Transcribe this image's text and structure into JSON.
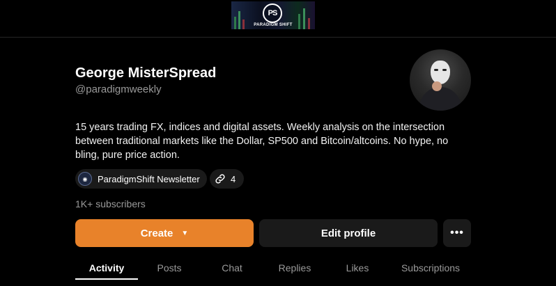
{
  "banner": {
    "logo_text": "PS",
    "brand_text": "PARADIGM SHIFT"
  },
  "profile": {
    "name": "George MisterSpread",
    "handle": "@paradigmweekly",
    "bio": "15 years trading FX, indices and digital assets. Weekly analysis on the intersection between traditional markets like the Dollar, SP500 and Bitcoin/altcoins. No hype, no bling, pure price action.",
    "subscribers": "1K+ subscribers"
  },
  "chips": {
    "newsletter_label": "ParadigmShift Newsletter",
    "links_count": "4"
  },
  "actions": {
    "create_label": "Create",
    "create_caret": "▼",
    "edit_label": "Edit profile",
    "more_label": "•••"
  },
  "tabs": [
    {
      "label": "Activity",
      "active": true
    },
    {
      "label": "Posts",
      "active": false
    },
    {
      "label": "Chat",
      "active": false
    },
    {
      "label": "Replies",
      "active": false
    },
    {
      "label": "Likes",
      "active": false
    },
    {
      "label": "Subscriptions",
      "active": false
    }
  ],
  "colors": {
    "accent": "#e8822a",
    "background": "#000000",
    "surface": "#1a1a1a",
    "muted_text": "#9a9a9a"
  },
  "icons": {
    "links": "link-icon",
    "more": "more-horizontal-icon",
    "caret": "caret-down-icon"
  }
}
